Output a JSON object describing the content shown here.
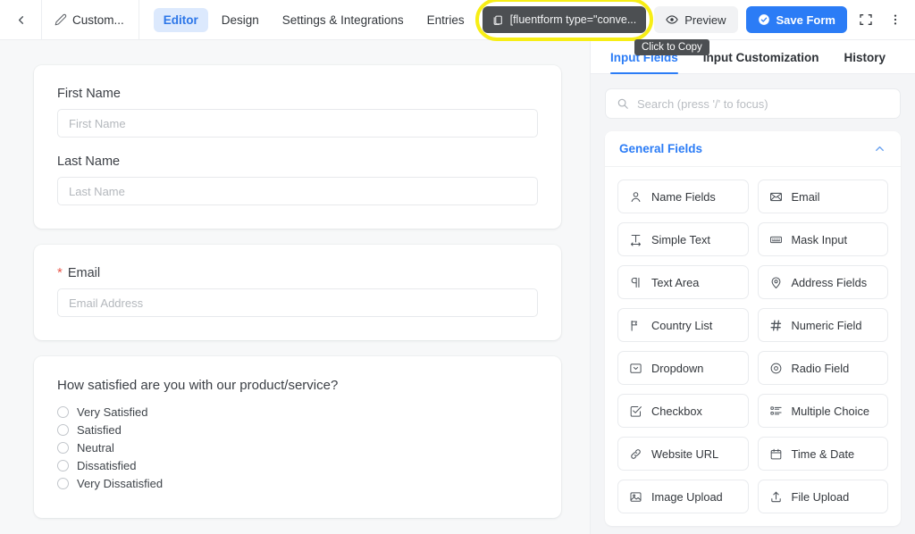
{
  "topbar": {
    "back_icon": "chevron-left-icon",
    "form_title": "Custom...",
    "pencil_icon": "pencil-icon",
    "tabs": [
      {
        "label": "Editor",
        "active": true
      },
      {
        "label": "Design",
        "active": false
      },
      {
        "label": "Settings & Integrations",
        "active": false
      },
      {
        "label": "Entries",
        "active": false
      }
    ],
    "shortcode": {
      "icon": "copy-icon",
      "text": "[fluentform type=\"conve...",
      "highlighted": true,
      "highlight_color": "#f7ee15"
    },
    "preview_label": "Preview",
    "preview_icon": "eye-icon",
    "save_label": "Save Form",
    "save_icon": "check-circle-icon",
    "save_color": "#2b7cf6",
    "fullscreen_icon": "fullscreen-icon",
    "more_icon": "more-vertical-icon"
  },
  "tooltip": {
    "text": "Click to Copy"
  },
  "canvas": {
    "cards": [
      {
        "type": "inputs",
        "fields": [
          {
            "label": "First Name",
            "placeholder": "First Name",
            "required": false
          },
          {
            "label": "Last Name",
            "placeholder": "Last Name",
            "required": false
          }
        ]
      },
      {
        "type": "inputs",
        "fields": [
          {
            "label": "Email",
            "placeholder": "Email Address",
            "required": true
          }
        ]
      },
      {
        "type": "radio",
        "question": "How satisfied are you with our product/service?",
        "options": [
          "Very Satisfied",
          "Satisfied",
          "Neutral",
          "Dissatisfied",
          "Very Dissatisfied"
        ]
      }
    ]
  },
  "panel": {
    "tabs": [
      {
        "label": "Input Fields",
        "active": true
      },
      {
        "label": "Input Customization",
        "active": false
      },
      {
        "label": "History",
        "active": false
      }
    ],
    "search": {
      "icon": "search-icon",
      "placeholder": "Search (press '/' to focus)",
      "value": ""
    },
    "group": {
      "title": "General Fields",
      "accent": "#2b7cf6",
      "collapse_icon": "chevron-up-icon",
      "expanded": true,
      "fields": [
        {
          "label": "Name Fields",
          "icon": "user-icon"
        },
        {
          "label": "Email",
          "icon": "envelope-icon"
        },
        {
          "label": "Simple Text",
          "icon": "text-width-icon"
        },
        {
          "label": "Mask Input",
          "icon": "mask-input-icon"
        },
        {
          "label": "Text Area",
          "icon": "paragraph-icon"
        },
        {
          "label": "Address Fields",
          "icon": "map-pin-icon"
        },
        {
          "label": "Country List",
          "icon": "flag-icon"
        },
        {
          "label": "Numeric Field",
          "icon": "hash-icon"
        },
        {
          "label": "Dropdown",
          "icon": "dropdown-icon"
        },
        {
          "label": "Radio Field",
          "icon": "radio-circle-icon"
        },
        {
          "label": "Checkbox",
          "icon": "checkbox-icon"
        },
        {
          "label": "Multiple Choice",
          "icon": "list-choice-icon"
        },
        {
          "label": "Website URL",
          "icon": "link-icon"
        },
        {
          "label": "Time & Date",
          "icon": "calendar-icon"
        },
        {
          "label": "Image Upload",
          "icon": "image-icon"
        },
        {
          "label": "File Upload",
          "icon": "upload-icon"
        }
      ]
    }
  }
}
